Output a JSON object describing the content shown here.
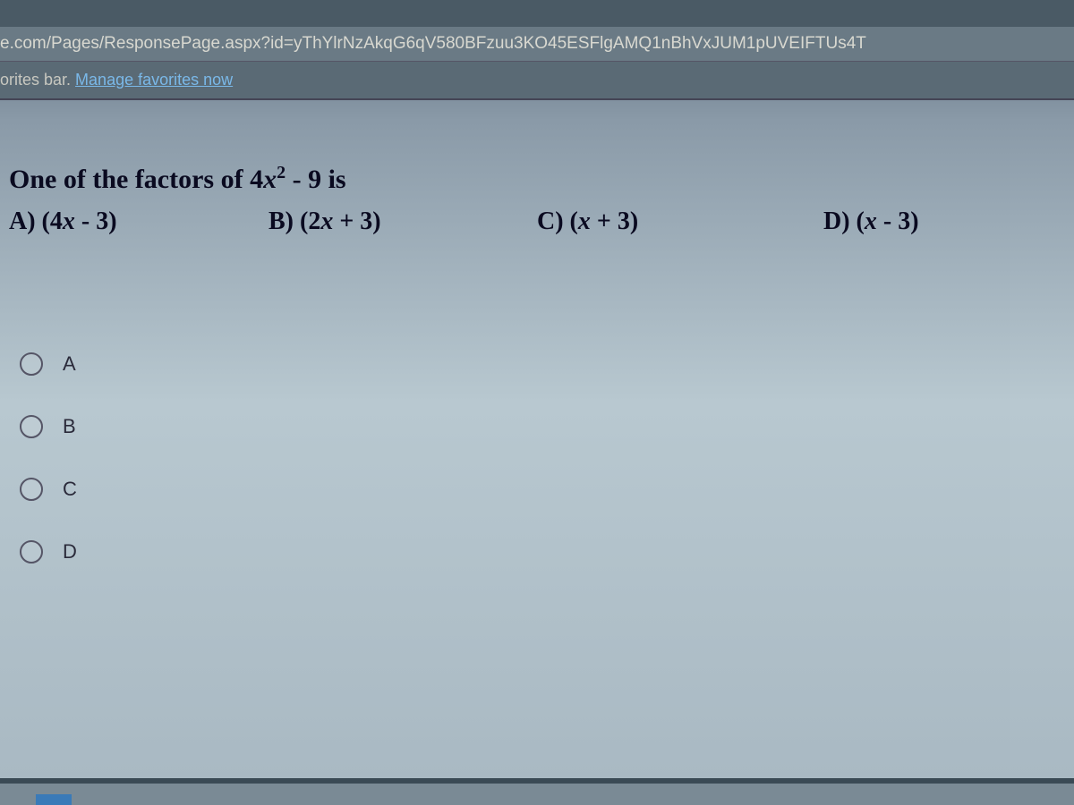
{
  "browser": {
    "url": "e.com/Pages/ResponsePage.aspx?id=yThYlrNzAkqG6qV580BFzuu3KO45ESFlgAMQ1nBhVxJUM1pUVEIFTUs4T",
    "favorites_prefix": "orites bar.  ",
    "favorites_link": "Manage favorites now"
  },
  "question": {
    "stem_prefix": "One of the factors of 4",
    "stem_var": "x",
    "stem_exp": "2",
    "stem_suffix": " - 9 is",
    "options": {
      "a_label": "A)",
      "a_text_pre": "  (4",
      "a_text_var": "x",
      "a_text_post": " - 3)",
      "b_label": "B)",
      "b_text_pre": "  (2",
      "b_text_var": "x",
      "b_text_post": " + 3)",
      "c_label": "C)",
      "c_text_pre": "  (",
      "c_text_var": "x",
      "c_text_post": " + 3)",
      "d_label": "D)",
      "d_text_pre": "  (",
      "d_text_var": "x",
      "d_text_post": " - 3)"
    }
  },
  "choices": {
    "a": "A",
    "b": "B",
    "c": "C",
    "d": "D"
  }
}
